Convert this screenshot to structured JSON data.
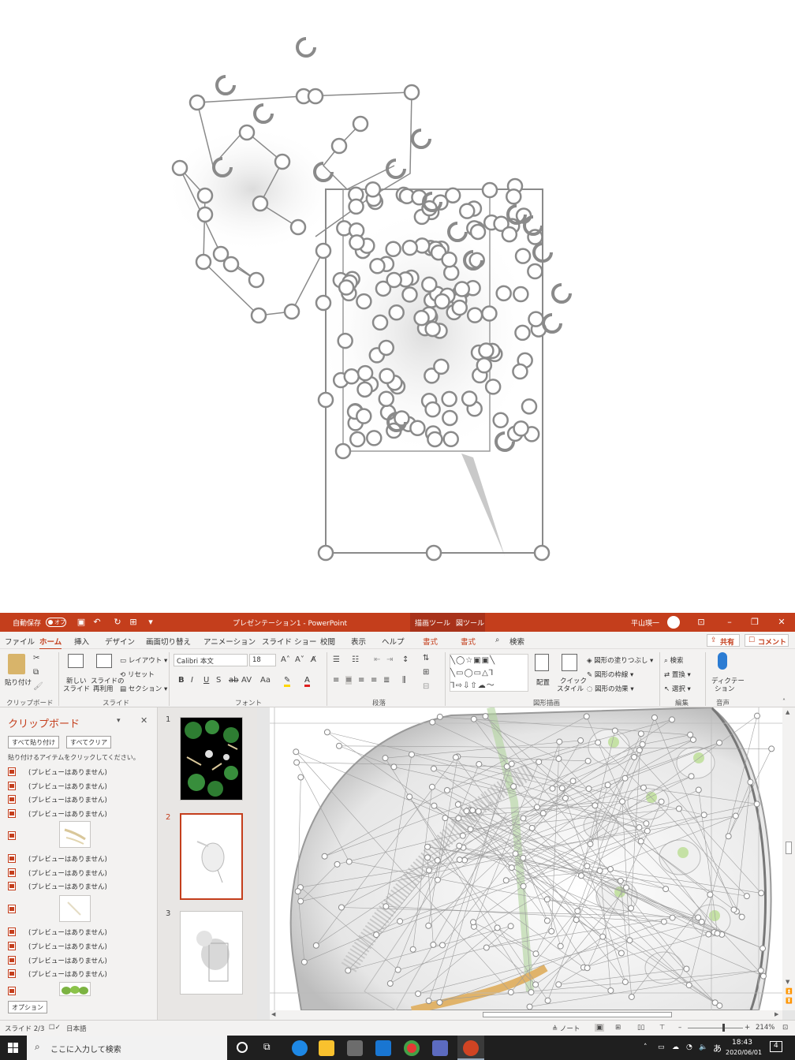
{
  "titlebar": {
    "autosave": "自動保存",
    "autosave_state": "オフ",
    "doc_title": "プレゼンテーション1  -  PowerPoint",
    "ctx_drawing": "描画ツール",
    "ctx_picture": "図ツール",
    "user": "平山瑛一"
  },
  "menu": {
    "file": "ファイル",
    "home": "ホーム",
    "insert": "挿入",
    "design": "デザイン",
    "transitions": "画面切り替え",
    "animations": "アニメーション",
    "slideshow": "スライド ショー",
    "review": "校閲",
    "view": "表示",
    "help": "ヘルプ",
    "format1": "書式",
    "format2": "書式",
    "search": "検索",
    "share": "共有",
    "comment": "コメント"
  },
  "ribbon": {
    "paste": "貼り付け",
    "new_slide_1": "新しい",
    "new_slide_2": "スライド",
    "reuse_1": "スライドの",
    "reuse_2": "再利用",
    "layout": "レイアウト",
    "reset": "リセット",
    "section": "セクション",
    "font_name": "Calibri 本文",
    "font_size": "18",
    "arrange": "配置",
    "quick_style_1": "クイック",
    "quick_style_2": "スタイル",
    "shape_fill": "図形の塗りつぶし",
    "shape_outline": "図形の枠線",
    "shape_effects": "図形の効果",
    "find": "検索",
    "replace": "置換",
    "select": "選択",
    "dictate_1": "ディクテー",
    "dictate_2": "ション",
    "groups": {
      "clipboard": "クリップボード",
      "slides": "スライド",
      "font": "フォント",
      "paragraph": "段落",
      "drawing": "図形描画",
      "editing": "編集",
      "voice": "音声"
    }
  },
  "clipboard": {
    "title": "クリップボード",
    "paste_all": "すべて貼り付け",
    "clear_all": "すべてクリア",
    "hint": "貼り付けるアイテムをクリックしてください。",
    "no_preview": "(プレビューはありません)",
    "options": "オプション"
  },
  "thumbs": {
    "n1": "1",
    "n2": "2",
    "n3": "3"
  },
  "status": {
    "slide": "スライド 2/3",
    "language": "日本語",
    "notes": "ノート",
    "zoom": "214%"
  },
  "taskbar": {
    "search": "ここに入力して検索",
    "ime": "あ",
    "time": "18:43",
    "date": "2020/06/01",
    "notif": "4"
  },
  "colors": {
    "accent": "#c43e1c",
    "handle": "#8a8a8a"
  }
}
